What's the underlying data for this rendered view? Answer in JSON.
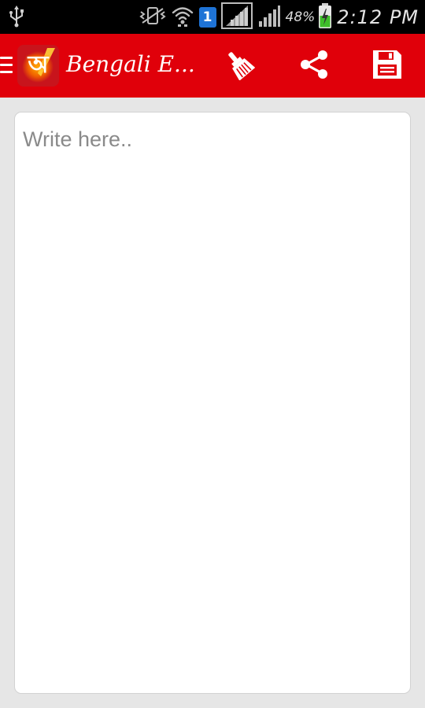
{
  "status_bar": {
    "battery_percent": "48%",
    "time": "2:12 PM",
    "sim_label": "1",
    "icons": [
      "usb-icon",
      "vibrate-icon",
      "wifi-icon",
      "sim-icon",
      "signal-box-icon",
      "signal-icon",
      "battery-charging-icon"
    ]
  },
  "app_bar": {
    "title": "Bengali E...",
    "logo_glyph": "অ",
    "background_color": "#e0000a",
    "actions": [
      {
        "name": "clear",
        "icon": "broom-icon"
      },
      {
        "name": "share",
        "icon": "share-icon"
      },
      {
        "name": "save",
        "icon": "save-icon"
      }
    ]
  },
  "editor": {
    "placeholder": "Write here..",
    "value": ""
  }
}
